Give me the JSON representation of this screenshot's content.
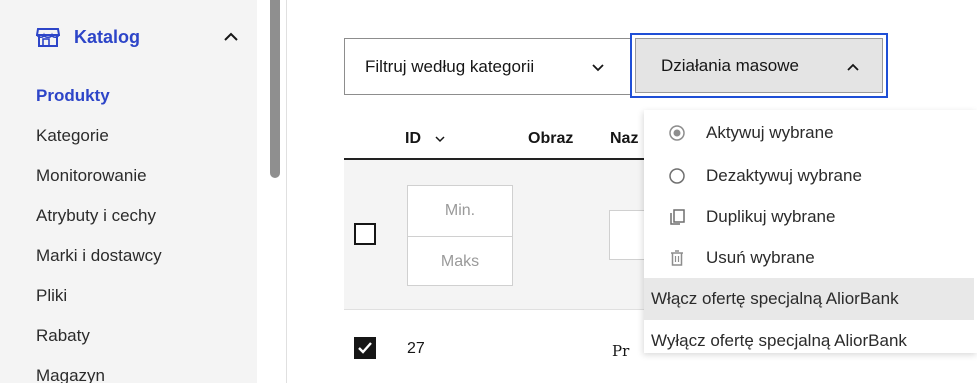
{
  "sidebar": {
    "section_title": "Katalog",
    "items": [
      {
        "label": "Produkty",
        "active": true
      },
      {
        "label": "Kategorie"
      },
      {
        "label": "Monitorowanie"
      },
      {
        "label": "Atrybuty i cechy"
      },
      {
        "label": "Marki i dostawcy"
      },
      {
        "label": "Pliki"
      },
      {
        "label": "Rabaty"
      },
      {
        "label": "Magazyn"
      }
    ]
  },
  "toolbar": {
    "filter_label": "Filtruj według kategorii",
    "bulk_label": "Działania masowe"
  },
  "table": {
    "headers": {
      "id": "ID",
      "image": "Obraz",
      "name": "Naz"
    },
    "filters": {
      "id_min_placeholder": "Min.",
      "id_max_placeholder": "Maks"
    },
    "rows": [
      {
        "id": "27",
        "name": "Pr",
        "selected": true
      }
    ]
  },
  "bulk_menu": {
    "items": [
      {
        "label": "Aktywuj wybrane",
        "icon": "radio-checked-icon"
      },
      {
        "label": "Dezaktywuj wybrane",
        "icon": "radio-empty-icon"
      },
      {
        "label": "Duplikuj wybrane",
        "icon": "copy-icon"
      },
      {
        "label": "Usuń wybrane",
        "icon": "trash-icon"
      },
      {
        "label": "Włącz ofertę specjalną AliorBank"
      },
      {
        "label": "Wyłącz ofertę specjalną AliorBank"
      }
    ]
  },
  "colors": {
    "accent": "#2d45c8",
    "focus_border": "#1f4fd6",
    "sidebar_bg": "#f4f4f4",
    "hover_bg": "#e8e8e8"
  }
}
